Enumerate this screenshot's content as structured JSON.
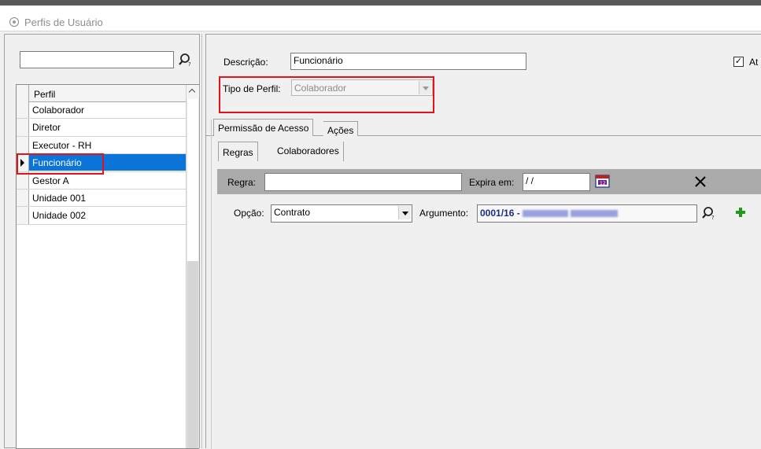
{
  "window": {
    "title": "Perfis de Usuário"
  },
  "left": {
    "search_value": "",
    "grid_header": "Perfil",
    "rows": [
      "Colaborador",
      "Diretor",
      "Executor - RH",
      "Funcionário",
      "Gestor A",
      "Unidade 001",
      "Unidade 002"
    ],
    "selected": "Funcionário"
  },
  "form": {
    "descricao_label": "Descrição:",
    "descricao_value": "Funcionário",
    "ativo_label": "At",
    "ativo_checked": true,
    "tipo_label": "Tipo de Perfil:",
    "tipo_value": "Colaborador"
  },
  "tabs": {
    "main": [
      "Permissão de Acesso",
      "Ações"
    ],
    "sub": [
      "Regras",
      "Colaboradores"
    ]
  },
  "rule": {
    "regra_label": "Regra:",
    "regra_value": "",
    "expira_label": "Expira em:",
    "expira_value": " / /",
    "opcao_label": "Opção:",
    "opcao_value": "Contrato",
    "argumento_label": "Argumento:",
    "argumento_value": "0001/16 -"
  },
  "colors": {
    "selection": "#0a74d8",
    "highlight": "#e4121a",
    "rule_bar": "#aaaaaa"
  }
}
